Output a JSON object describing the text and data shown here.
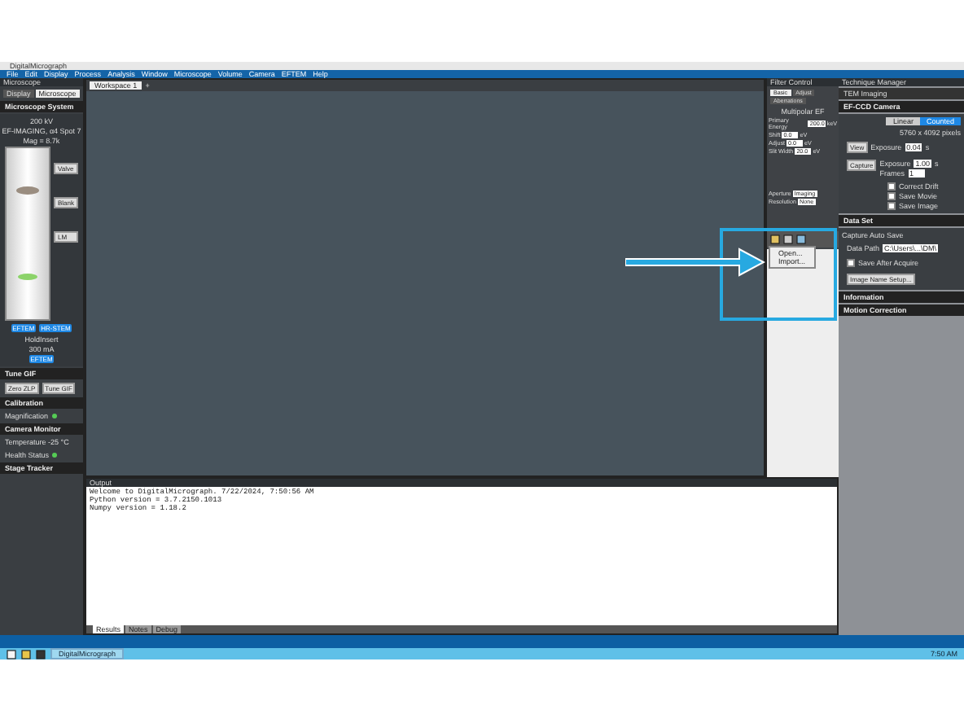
{
  "window": {
    "title": "DigitalMicrograph"
  },
  "menu": [
    "File",
    "Edit",
    "Display",
    "Process",
    "Analysis",
    "Window",
    "Microscope",
    "Volume",
    "Camera",
    "EFTEM",
    "Help"
  ],
  "microscope_panel": {
    "title": "Microscope",
    "tabs": [
      {
        "label": "Display",
        "selected": false
      },
      {
        "label": "Microscope",
        "selected": true
      }
    ],
    "header": "Microscope System",
    "info": [
      "200 kV",
      "EF-IMAGING, α4 Spot 7",
      "Mag = 8.7k"
    ],
    "buttons": [
      "Valve",
      "Blank",
      "LM"
    ],
    "badges": [
      "EFTEM",
      "HR-STEM"
    ],
    "holder": [
      "HoldInsert",
      "300 mA"
    ],
    "mode_badge": "EFTEM"
  },
  "left_sections": [
    {
      "title": "Tune GIF",
      "buttons": [
        "Zero ZLP",
        "Tune GIF"
      ]
    },
    {
      "title": "Calibration",
      "rows": [
        {
          "label": "Magnification",
          "ok": true
        }
      ]
    },
    {
      "title": "Camera Monitor",
      "rows": [
        {
          "label": "Temperature -25 °C"
        },
        {
          "label": "Health Status",
          "ok": true
        }
      ]
    },
    {
      "title": "Stage Tracker"
    }
  ],
  "workspace": {
    "tabs": [
      {
        "label": "Workspace 1",
        "selected": true
      }
    ],
    "add": "+"
  },
  "filter_panel": {
    "title": "Filter Control",
    "tabs": [
      {
        "label": "Basic",
        "selected": true
      },
      {
        "label": "Adjust",
        "selected": false
      },
      {
        "label": "Aberrations",
        "selected": false
      }
    ],
    "header": "Multipolar EF",
    "rows": [
      {
        "label": "Primary Energy",
        "value": "200.0",
        "unit": "keV"
      },
      {
        "label": "Shift",
        "value": "0.0",
        "unit": "eV"
      },
      {
        "label": "Adjust",
        "value": "0.0",
        "unit": "eV"
      },
      {
        "label": "Slit Width",
        "value": "20.0",
        "unit": "eV"
      }
    ],
    "selects": [
      {
        "label": "Aperture",
        "value": "Imaging"
      },
      {
        "label": "Resolution",
        "value": "None"
      }
    ],
    "menu": [
      "Open...",
      "Import..."
    ]
  },
  "technique_panel": {
    "title": "Technique Manager",
    "tab": "TEM Imaging",
    "camera": "EF-CCD Camera",
    "modes": [
      {
        "label": "Linear",
        "selected": false
      },
      {
        "label": "Counted",
        "selected": true
      }
    ],
    "size": "5760 x 4092 pixels",
    "view": {
      "button": "View",
      "label": "Exposure",
      "value": "0.04",
      "unit": "s"
    },
    "capture": {
      "button": "Capture",
      "label": "Exposure",
      "value": "1.00",
      "unit": "s",
      "frames_label": "Frames",
      "frames": "1"
    },
    "options": [
      {
        "label": "Correct Drift",
        "checked": false
      },
      {
        "label": "Save Movie",
        "checked": false
      },
      {
        "label": "Save Image",
        "checked": false
      }
    ],
    "data_set": {
      "title": "Data Set",
      "group": "Capture Auto Save",
      "path_label": "Data Path",
      "path": "C:\\Users\\...\\DM\\",
      "save_after": {
        "label": "Save After Acquire",
        "checked": false
      },
      "button": "Image Name Setup..."
    },
    "sections": [
      "Information",
      "Motion Correction"
    ]
  },
  "output": {
    "title": "Output",
    "lines": [
      "Welcome to DigitalMicrograph.  7/22/2024, 7:50:56 AM",
      "Python version = 3.7.2150.1013",
      "Numpy version = 1.18.2"
    ],
    "tabs": [
      {
        "label": "Results",
        "selected": true
      },
      {
        "label": "Notes",
        "selected": false
      },
      {
        "label": "Debug",
        "selected": false
      }
    ]
  },
  "taskbar": {
    "app": "DigitalMicrograph",
    "clock": "7:50 AM"
  }
}
